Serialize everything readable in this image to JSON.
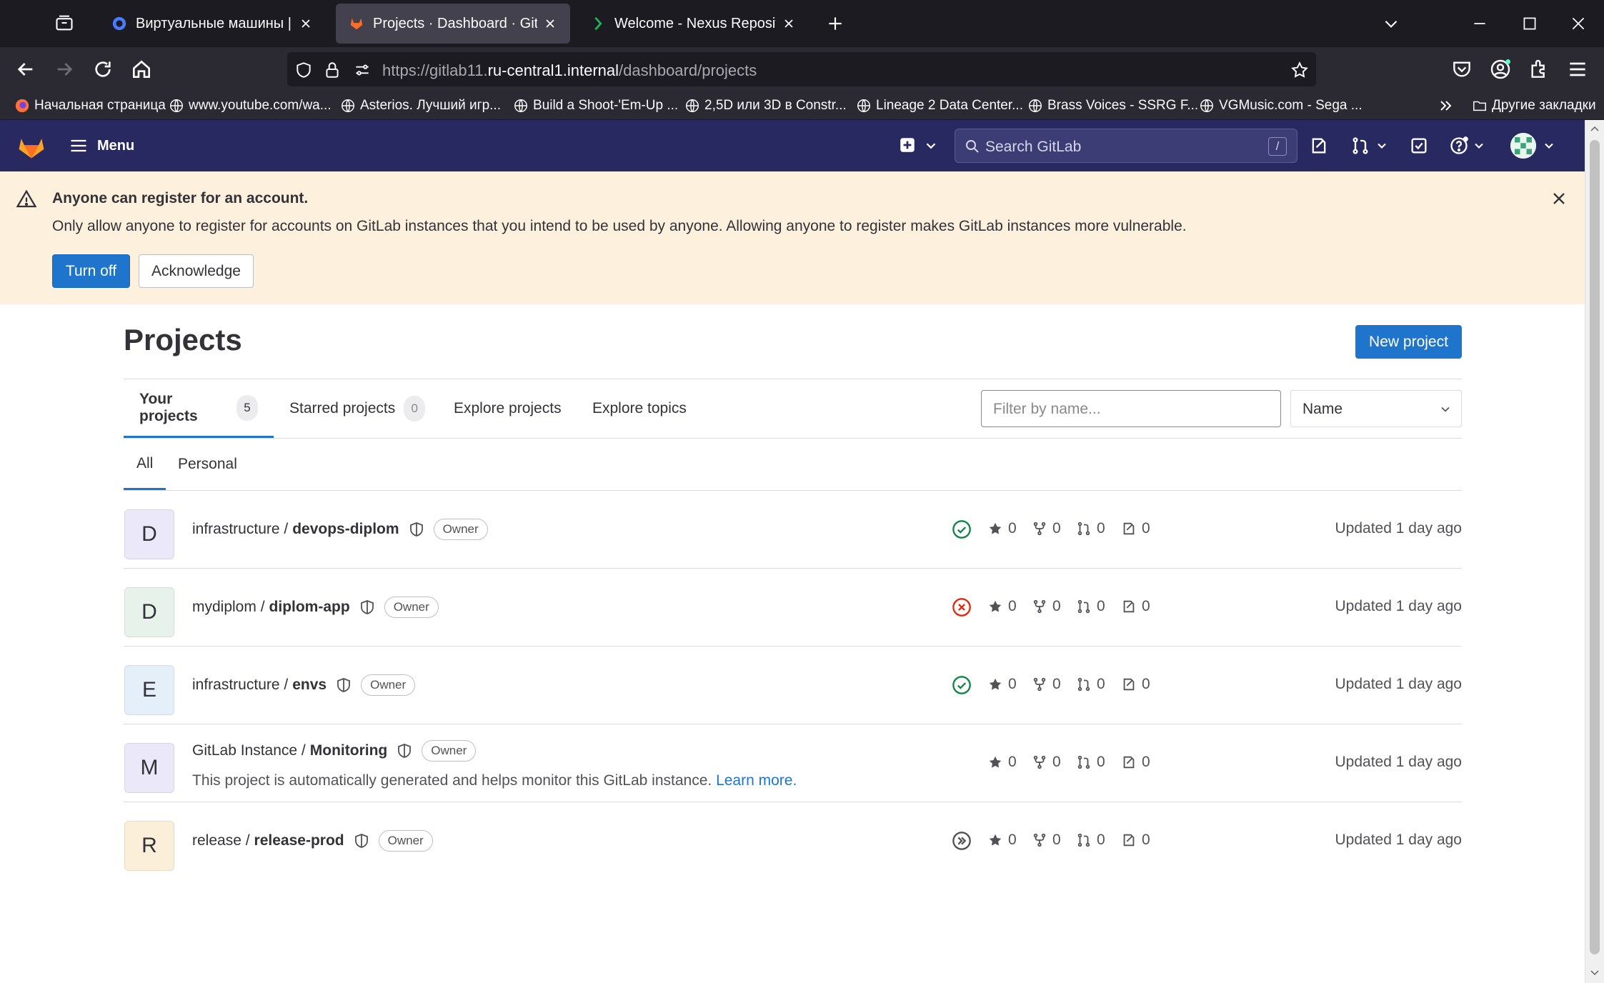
{
  "browser": {
    "tabs": [
      {
        "title": "Виртуальные машины | Yandex",
        "active": false
      },
      {
        "title": "Projects · Dashboard · GitLab",
        "active": true
      },
      {
        "title": "Welcome - Nexus Repository M",
        "active": false
      }
    ],
    "url_prefix": "https://gitlab11.",
    "url_domain": "ru-central1.internal",
    "url_path": "/dashboard/projects",
    "bookmarks": [
      "Начальная страница",
      "www.youtube.com/wa...",
      "Asterios. Лучший игр...",
      "Build a Shoot-'Em-Up ...",
      "2,5D или 3D в Constr...",
      "Lineage 2 Data Center...",
      "Brass Voices - SSRG F...",
      "VGMusic.com - Sega ..."
    ],
    "other_bookmarks": "Другие закладки"
  },
  "gitlab_header": {
    "menu_label": "Menu",
    "search_placeholder": "Search GitLab",
    "search_shortcut": "/"
  },
  "alert": {
    "title": "Anyone can register for an account.",
    "body": "Only allow anyone to register for accounts on GitLab instances that you intend to be used by anyone. Allowing anyone to register makes GitLab instances more vulnerable.",
    "turn_off_label": "Turn off",
    "acknowledge_label": "Acknowledge"
  },
  "page": {
    "title": "Projects",
    "new_project_label": "New project",
    "tabs": [
      {
        "label": "Your projects",
        "count": "5"
      },
      {
        "label": "Starred projects",
        "count": "0"
      },
      {
        "label": "Explore projects"
      },
      {
        "label": "Explore topics"
      }
    ],
    "filter_placeholder": "Filter by name...",
    "sort_value": "Name",
    "sub_tabs": [
      "All",
      "Personal"
    ]
  },
  "projects": [
    {
      "initial": "D",
      "namespace": "infrastructure /",
      "name": "devops-diplom",
      "role": "Owner",
      "pipeline": "success",
      "stars": "0",
      "forks": "0",
      "merge_requests": "0",
      "issues": "0",
      "updated": "Updated 1 day ago",
      "avatar_color": "#eae8f9"
    },
    {
      "initial": "D",
      "namespace": "mydiplom /",
      "name": "diplom-app",
      "role": "Owner",
      "pipeline": "failed",
      "stars": "0",
      "forks": "0",
      "merge_requests": "0",
      "issues": "0",
      "updated": "Updated 1 day ago",
      "avatar_color": "#e6f2ea"
    },
    {
      "initial": "E",
      "namespace": "infrastructure /",
      "name": "envs",
      "role": "Owner",
      "pipeline": "success",
      "stars": "0",
      "forks": "0",
      "merge_requests": "0",
      "issues": "0",
      "updated": "Updated 1 day ago",
      "avatar_color": "#e4eff9"
    },
    {
      "initial": "M",
      "namespace": "GitLab Instance /",
      "name": "Monitoring",
      "role": "Owner",
      "pipeline": "none",
      "stars": "0",
      "forks": "0",
      "merge_requests": "0",
      "issues": "0",
      "updated": "Updated 1 day ago",
      "avatar_color": "#eae8f9",
      "description": "This project is automatically generated and helps monitor this GitLab instance.",
      "description_link": "Learn more."
    },
    {
      "initial": "R",
      "namespace": "release /",
      "name": "release-prod",
      "role": "Owner",
      "pipeline": "skipped",
      "stars": "0",
      "forks": "0",
      "merge_requests": "0",
      "issues": "0",
      "updated": "Updated 1 day ago",
      "avatar_color": "#fcefd9"
    }
  ],
  "colors": {
    "header_bg": "#292961",
    "primary": "#1f75cb",
    "success": "#108548",
    "danger": "#dd2b0e",
    "alert_bg": "#fdf1dd"
  }
}
